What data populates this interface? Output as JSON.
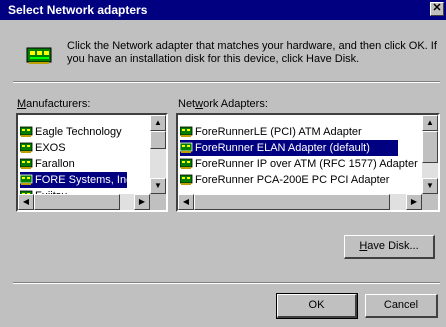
{
  "window": {
    "title": "Select Network adapters",
    "close_glyph": "✕"
  },
  "intro": {
    "text": "Click the Network adapter that matches your hardware, and then click OK. If you have an installation disk for this device, click Have Disk.",
    "icon": "network-adapter-icon"
  },
  "manufacturers": {
    "label_prefix": "",
    "label_underlined": "M",
    "label_rest": "anufacturers:",
    "items": [
      {
        "label": "Eagle Technology",
        "selected": false
      },
      {
        "label": "EXOS",
        "selected": false
      },
      {
        "label": "Farallon",
        "selected": false
      },
      {
        "label": "FORE Systems, Inc.",
        "selected": true
      },
      {
        "label": "Fujitsu",
        "selected": false
      }
    ]
  },
  "adapters": {
    "label_prefix": "Net",
    "label_underlined": "w",
    "label_rest": "ork Adapters:",
    "items": [
      {
        "label": "ForeRunnerLE (PCI) ATM Adapter",
        "selected": false
      },
      {
        "label": "ForeRunner ELAN Adapter (default)",
        "selected": true
      },
      {
        "label": "ForeRunner IP over ATM (RFC 1577) Adapter",
        "selected": false
      },
      {
        "label": "ForeRunner PCA-200E PC PCI Adapter",
        "selected": false
      }
    ]
  },
  "buttons": {
    "have_disk_underlined": "H",
    "have_disk_rest": "ave Disk...",
    "ok": "OK",
    "cancel": "Cancel"
  },
  "colors": {
    "title_bar": "#000080",
    "selection": "#000080",
    "face": "#c0c0c0"
  }
}
